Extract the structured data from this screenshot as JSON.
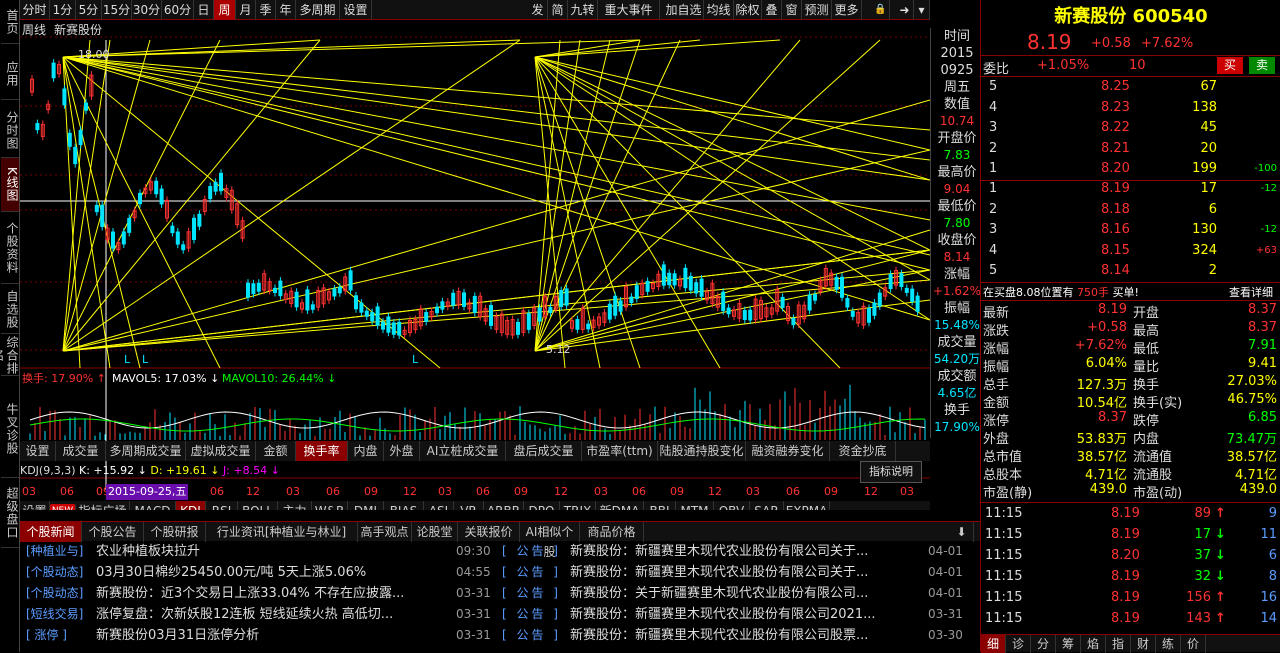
{
  "left_rail": [
    "首页",
    "应用",
    "分时图",
    "K线图",
    "个股资料",
    "自选股",
    "综合排名",
    "牛叉诊股",
    "超级盘口"
  ],
  "periods": [
    "分时",
    "1分",
    "5分",
    "15分",
    "30分",
    "60分",
    "日",
    "周",
    "月",
    "季",
    "年",
    "多周期",
    "设置"
  ],
  "toolbar_right": [
    "发",
    "简",
    "九转",
    "重大事件",
    "加自选",
    "均线",
    "除权",
    "叠",
    "窗",
    "预测",
    "更多"
  ],
  "chart_title": "周线",
  "stock_name_label": "新赛股份",
  "price_top": "18.00",
  "price_low": "5.12",
  "k_markers": [
    "L",
    "L",
    "L"
  ],
  "info": {
    "time_label": "时间",
    "year": "2015",
    "date": "0925",
    "weekday": "周五",
    "value_label": "数值",
    "value": "10.74",
    "open_label": "开盘价",
    "open": "7.83",
    "high_label": "最高价",
    "high": "9.04",
    "low_label": "最低价",
    "low": "7.80",
    "close_label": "收盘价",
    "close": "8.14",
    "change_label": "涨幅",
    "change": "+1.62%",
    "amp_label": "振幅",
    "amp": "15.48%",
    "vol_label": "成交量",
    "vol": "54.20万",
    "amt_label": "成交额",
    "amt": "4.65亿",
    "turnover_label": "换手",
    "turnover": "17.90%"
  },
  "indicator": {
    "turnover": "换手: 17.90%",
    "mavol5": "MAVOL5: 17.03%",
    "mavol10": "MAVOL10: 26.44%"
  },
  "ind_tabs": [
    "设置",
    "成交量",
    "多周期成交量",
    "虚拟成交量",
    "金额",
    "换手率",
    "内盘",
    "外盘",
    "AI立桩成交量",
    "盘后成交量",
    "市盈率(ttm)",
    "陆股通持股变化",
    "融资融券变化",
    "资金抄底"
  ],
  "kdj": {
    "label": "KDJ(9,3,3)",
    "k": "K: +15.92",
    "d": "D: +19.61",
    "j": "J: +8.54",
    "btn": "指标说明",
    "right_val": "-51.84"
  },
  "time_axis": [
    "03",
    "06",
    "09",
    "2015-09-25,五",
    "06",
    "12",
    "03",
    "06",
    "09",
    "12",
    "03",
    "06",
    "09",
    "12",
    "03",
    "06",
    "09",
    "12",
    "03",
    "06",
    "09",
    "12",
    "03"
  ],
  "ind_names": [
    "设置",
    "NEW",
    "指标广场",
    "MACD",
    "KDJ",
    "RSI",
    "BOLL",
    "主力",
    "W&R",
    "DMI",
    "BIAS",
    "ASI",
    "VR",
    "ARBR",
    "DPO",
    "TRIX",
    "新DMA",
    "BBI",
    "MTM",
    "OBV",
    "SAR",
    "EXPMA"
  ],
  "news_tabs": [
    "个股新闻",
    "个股公告",
    "个股研报",
    "行业资讯[种植业与林业]",
    "高手观点",
    "论股堂",
    "关联报价",
    "AI相似个股",
    "商品价格"
  ],
  "news": [
    {
      "tag": "[种植业与]",
      "title": "农业种植板块拉升",
      "time": "09:30",
      "type": "[ 公告 ]",
      "ann": "新赛股份：新疆赛里木现代农业股份有限公司关于...",
      "date": "04-01"
    },
    {
      "tag": "[个股动态]",
      "title": "03月30日棉纱25450.00元/吨 5天上涨5.06%",
      "time": "04:55",
      "type": "[ 公告 ]",
      "ann": "新赛股份：新疆赛里木现代农业股份有限公司关于...",
      "date": "04-01"
    },
    {
      "tag": "[个股动态]",
      "title": "新赛股份：近3个交易日上涨33.04% 不存在应披露...",
      "time": "03-31",
      "type": "[ 公告 ]",
      "ann": "新赛股份：关于新疆赛里木现代农业股份有限公司...",
      "date": "04-01"
    },
    {
      "tag": "[短线交易]",
      "title": "涨停复盘：次新妖股12连板 短线延续火热 高低切...",
      "time": "03-31",
      "type": "[ 公告 ]",
      "ann": "新赛股份：新疆赛里木现代农业股份有限公司2021...",
      "date": "03-31"
    },
    {
      "tag": "[  涨停  ]",
      "title": "新赛股份03月31日涨停分析",
      "time": "03-31",
      "type": "[ 公告 ]",
      "ann": "新赛股份：新疆赛里木现代农业股份有限公司股票...",
      "date": "03-30"
    }
  ],
  "quote": {
    "name": "新赛股份 600540",
    "price": "8.19",
    "change": "+0.58",
    "pct": "+7.62%",
    "weibi_label": "委比",
    "weibi": "+1.05%",
    "weicha": "10",
    "buy_btn": "买",
    "sell_btn": "卖",
    "sells": [
      {
        "n": "5",
        "p": "8.25",
        "v": "67",
        "d": ""
      },
      {
        "n": "4",
        "p": "8.23",
        "v": "138",
        "d": ""
      },
      {
        "n": "3",
        "p": "8.22",
        "v": "45",
        "d": ""
      },
      {
        "n": "2",
        "p": "8.21",
        "v": "20",
        "d": ""
      },
      {
        "n": "1",
        "p": "8.20",
        "v": "199",
        "d": "-100"
      }
    ],
    "buys": [
      {
        "n": "1",
        "p": "8.19",
        "v": "17",
        "d": "-12"
      },
      {
        "n": "2",
        "p": "8.18",
        "v": "6",
        "d": ""
      },
      {
        "n": "3",
        "p": "8.16",
        "v": "130",
        "d": "-12"
      },
      {
        "n": "4",
        "p": "8.15",
        "v": "324",
        "d": "+63"
      },
      {
        "n": "5",
        "p": "8.14",
        "v": "2",
        "d": ""
      }
    ],
    "notice": "在买盘8.08位置有",
    "notice_vol": "750手",
    "notice_tail": "买单!",
    "notice_link": "查看详细",
    "stats": [
      [
        "最新",
        "8.19",
        "开盘",
        "8.37"
      ],
      [
        "涨跌",
        "+0.58",
        "最高",
        "8.37"
      ],
      [
        "涨幅",
        "+7.62%",
        "最低",
        "7.91"
      ],
      [
        "振幅",
        "6.04%",
        "量比",
        "9.41"
      ],
      [
        "总手",
        "127.3万",
        "换手",
        "27.03%"
      ],
      [
        "金额",
        "10.54亿",
        "换手(实)",
        "46.75%"
      ],
      [
        "涨停",
        "8.37",
        "跌停",
        "6.85"
      ],
      [
        "外盘",
        "53.83万",
        "内盘",
        "73.47万"
      ],
      [
        "总市值",
        "38.57亿",
        "流通值",
        "38.57亿"
      ],
      [
        "总股本",
        "4.71亿",
        "流通股",
        "4.71亿"
      ],
      [
        "市盈(静)",
        "439.0",
        "市盈(动)",
        "439.0"
      ]
    ],
    "ticks": [
      {
        "t": "11:15",
        "p": "8.19",
        "v": "89",
        "dir": "up",
        "n": "9"
      },
      {
        "t": "11:15",
        "p": "8.19",
        "v": "17",
        "dir": "down",
        "n": "11"
      },
      {
        "t": "11:15",
        "p": "8.20",
        "v": "37",
        "dir": "down",
        "n": "6"
      },
      {
        "t": "11:15",
        "p": "8.19",
        "v": "32",
        "dir": "down",
        "n": "8"
      },
      {
        "t": "11:15",
        "p": "8.19",
        "v": "156",
        "dir": "up",
        "n": "16"
      },
      {
        "t": "11:15",
        "p": "8.19",
        "v": "143",
        "dir": "up",
        "n": "14"
      }
    ],
    "bottom_tabs": [
      "细",
      "诊",
      "分",
      "筹",
      "焰",
      "指",
      "财",
      "练",
      "价"
    ]
  },
  "colors": {
    "up": "#ff3232",
    "down": "#00d000",
    "yellow": "#ffff00",
    "cyan": "#00e5ff",
    "text": "#cccccc"
  }
}
